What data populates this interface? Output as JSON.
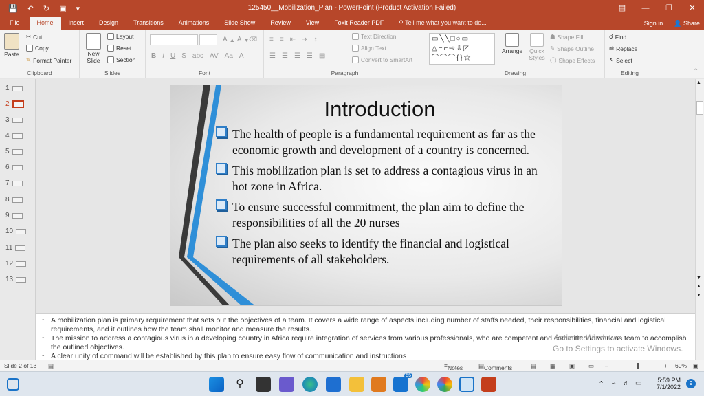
{
  "window": {
    "title": "125450__Mobilization_Plan - PowerPoint (Product Activation Failed)"
  },
  "tabs": [
    "File",
    "Home",
    "Insert",
    "Design",
    "Transitions",
    "Animations",
    "Slide Show",
    "Review",
    "View",
    "Foxit Reader PDF"
  ],
  "tell_me": "Tell me what you want to do...",
  "sign_in": "Sign in",
  "share": "Share",
  "ribbon": {
    "clipboard": {
      "paste": "Paste",
      "cut": "Cut",
      "copy": "Copy",
      "format_painter": "Format Painter",
      "label": "Clipboard"
    },
    "slides": {
      "new_slide": "New Slide",
      "layout": "Layout",
      "reset": "Reset",
      "section": "Section",
      "label": "Slides"
    },
    "font": {
      "label": "Font"
    },
    "paragraph": {
      "text_direction": "Text Direction",
      "align_text": "Align Text",
      "smartart": "Convert to SmartArt",
      "label": "Paragraph"
    },
    "drawing": {
      "arrange": "Arrange",
      "quick_styles": "Quick Styles",
      "shape_fill": "Shape Fill",
      "shape_outline": "Shape Outline",
      "shape_effects": "Shape Effects",
      "label": "Drawing"
    },
    "editing": {
      "find": "Find",
      "replace": "Replace",
      "select": "Select",
      "label": "Editing"
    }
  },
  "slide_numbers": [
    "1",
    "2",
    "3",
    "4",
    "5",
    "6",
    "7",
    "8",
    "9",
    "10",
    "11",
    "12",
    "13"
  ],
  "selected_slide": "2",
  "slide": {
    "title": "Introduction",
    "bullets": [
      "The health of  people is a fundamental requirement as far as the economic growth and development of a country is concerned.",
      "This mobilization plan is set to address a contagious virus in an hot zone in Africa.",
      "To ensure successful commitment, the plan aim to define the responsibilities of all the 20 nurses",
      "The plan also seeks to identify the financial and logistical requirements of all stakeholders."
    ]
  },
  "notes": [
    "A mobilization plan is primary requirement that sets out the objectives of a team. It covers a wide range of aspects including number of staffs needed, their responsibilities, financial and logistical requirements, and it outlines how the team shall monitor and measure the results.",
    " The mission to address a contagious virus in a developing country in Africa require integration of services from various professionals, who are competent and committed to work as team to accomplish the outlined objectives.",
    "A clear unity of command will be established by this plan to ensure easy flow of communication  and instructions"
  ],
  "watermark": {
    "line1": "Activate Windows",
    "line2": "Go to Settings to activate Windows."
  },
  "status": {
    "slide_info": "Slide 2 of 13",
    "notes": "Notes",
    "comments": "Comments",
    "zoom": "60%"
  },
  "taskbar": {
    "time": "5:59 PM",
    "date": "7/1/2022",
    "mail_badge": "55",
    "notif_badge": "9"
  },
  "colors": {
    "accent": "#b7472a",
    "bullet_blue": "#2f7ec7"
  }
}
